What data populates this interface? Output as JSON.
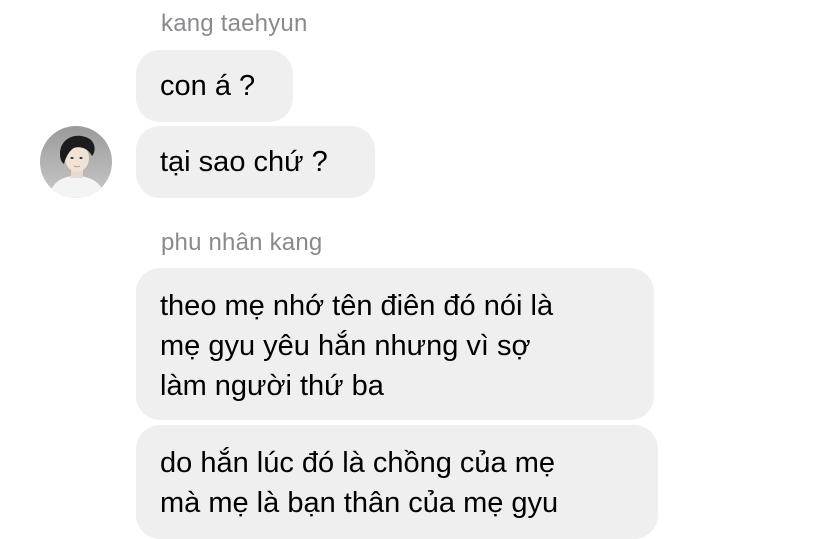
{
  "groups": [
    {
      "sender": "kang taehyun",
      "messages": [
        {
          "lines": [
            "con á ?"
          ]
        },
        {
          "lines": [
            "tại sao chứ ?"
          ]
        }
      ]
    },
    {
      "sender": "phu nhân kang",
      "messages": [
        {
          "lines": [
            "theo mẹ nhớ tên điên đó nói là",
            "mẹ gyu yêu hắn nhưng vì sợ",
            "làm người thứ ba"
          ]
        },
        {
          "lines": [
            "do hắn lúc đó là chồng của mẹ",
            "mà mẹ là bạn thân của mẹ gyu"
          ]
        }
      ]
    }
  ],
  "colors": {
    "bubble": "#efefef",
    "sender_name": "#8a8a8e",
    "text": "#000000"
  },
  "icons": {
    "avatar": "profile-photo"
  }
}
